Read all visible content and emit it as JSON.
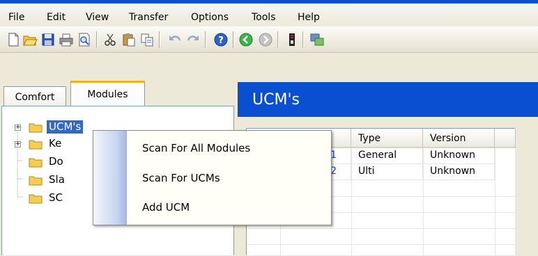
{
  "menu": {
    "items": [
      "File",
      "Edit",
      "View",
      "Transfer",
      "Options",
      "Tools",
      "Help"
    ]
  },
  "toolbar": {
    "icons": [
      "new-icon",
      "open-icon",
      "save-icon",
      "print-icon",
      "print-preview-icon",
      "cut-icon",
      "paste-icon",
      "copy-icon",
      "undo-icon",
      "redo-icon",
      "help-icon",
      "back-icon",
      "forward-icon",
      "receive-icon",
      "transfer-icon"
    ]
  },
  "tabs": {
    "comfort": "Comfort",
    "modules": "Modules"
  },
  "tree": {
    "items": [
      {
        "label": "UCM's",
        "expandable": true,
        "selected": true
      },
      {
        "label": "Ke",
        "expandable": true
      },
      {
        "label": "Do",
        "expandable": false
      },
      {
        "label": "Sla",
        "expandable": false
      },
      {
        "label": "SC",
        "expandable": false
      }
    ]
  },
  "panel": {
    "title": "UCM's"
  },
  "grid": {
    "columns": [
      "",
      "Type",
      "Version"
    ],
    "rows": [
      {
        "num": "1",
        "type": "General",
        "version": "Unknown"
      },
      {
        "num": "2",
        "type": "Ulti",
        "version": "Unknown"
      }
    ]
  },
  "context_menu": {
    "items": [
      "Scan For All Modules",
      "Scan For UCMs",
      "Add UCM"
    ]
  },
  "colors": {
    "title_blue": "#0a4fcf",
    "selection": "#316ac5",
    "chrome": "#ece9d8"
  }
}
